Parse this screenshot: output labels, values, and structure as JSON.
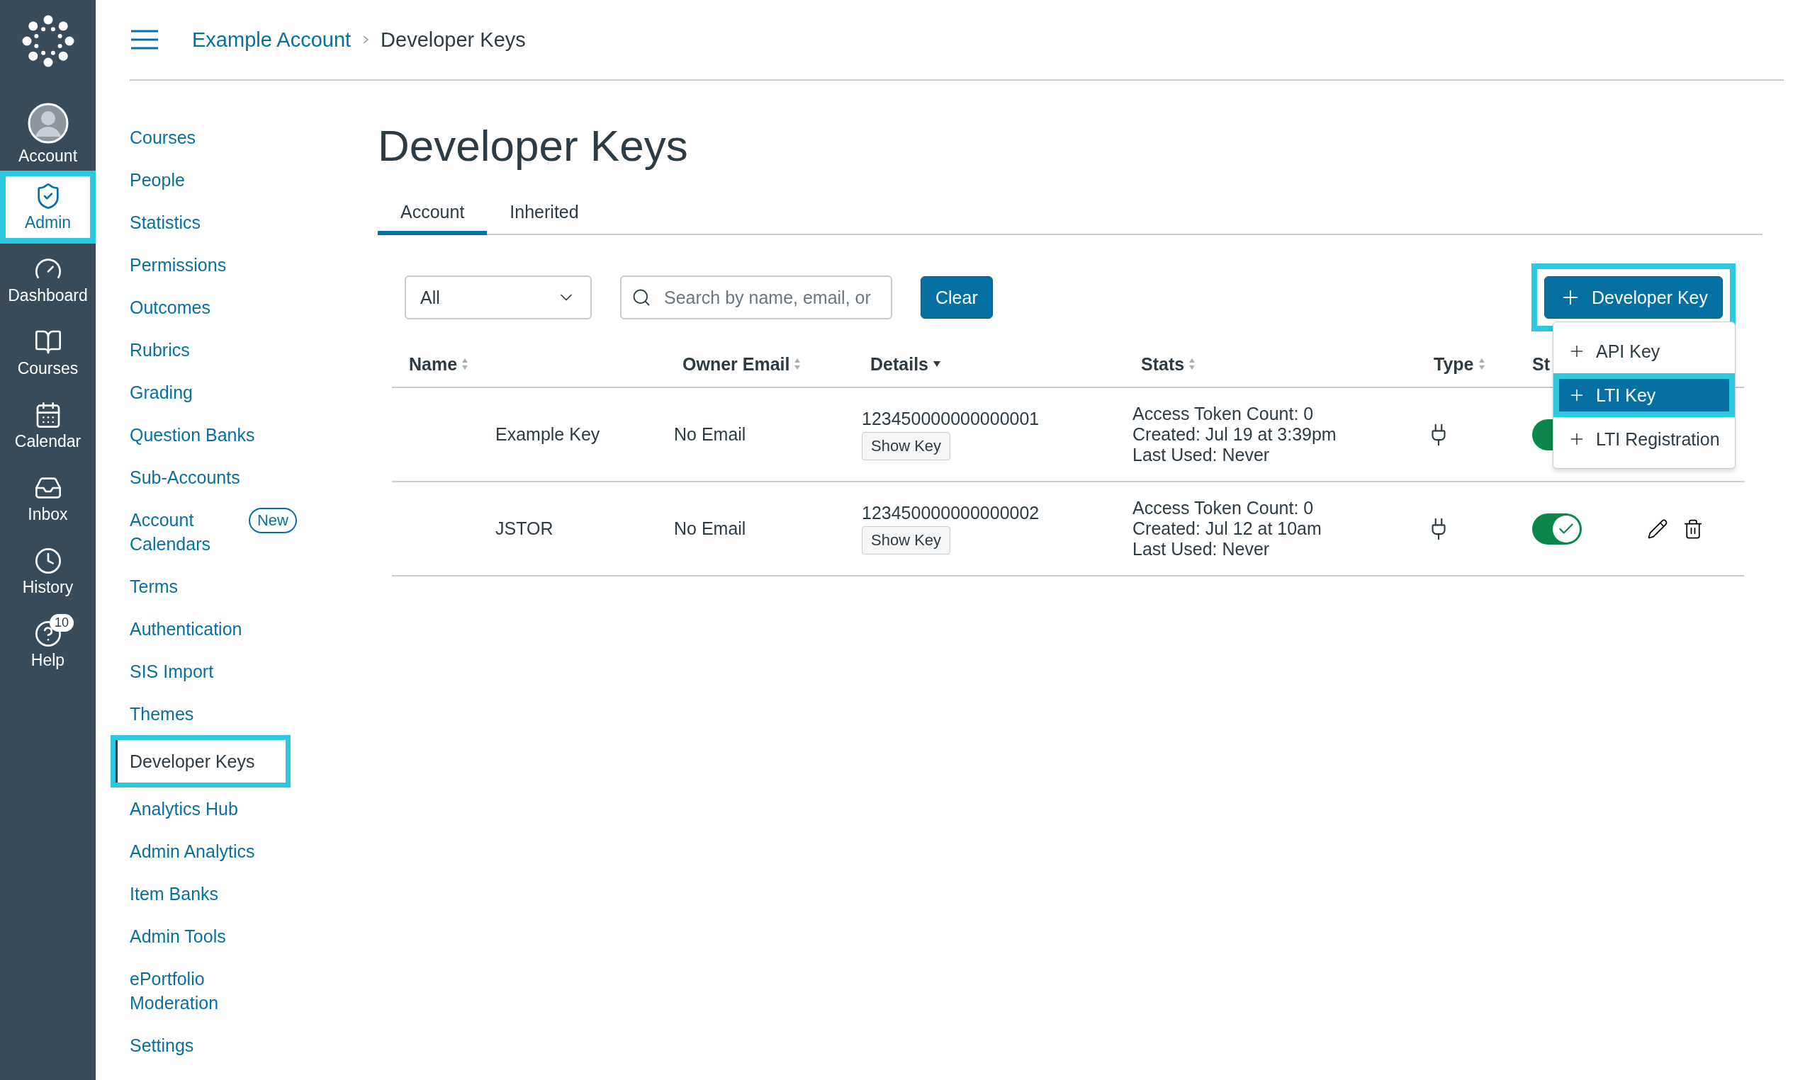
{
  "rail": {
    "items": [
      {
        "label": "Account",
        "kind": "avatar",
        "selected": false,
        "highlighted": false
      },
      {
        "label": "Admin",
        "kind": "admin",
        "selected": true,
        "highlighted": true
      },
      {
        "label": "Dashboard",
        "kind": "dashboard",
        "selected": false,
        "highlighted": false
      },
      {
        "label": "Courses",
        "kind": "courses",
        "selected": false,
        "highlighted": false
      },
      {
        "label": "Calendar",
        "kind": "calendar",
        "selected": false,
        "highlighted": false
      },
      {
        "label": "Inbox",
        "kind": "inbox",
        "selected": false,
        "highlighted": false
      },
      {
        "label": "History",
        "kind": "history",
        "selected": false,
        "highlighted": false
      },
      {
        "label": "Help",
        "kind": "help",
        "selected": false,
        "highlighted": false,
        "badge": "10"
      }
    ]
  },
  "breadcrumb": [
    {
      "label": "Example Account",
      "kind": "link"
    },
    {
      "label": "Developer Keys",
      "kind": "current"
    }
  ],
  "sidebar": {
    "items": [
      {
        "label": "Courses",
        "selected": false,
        "highlighted": false
      },
      {
        "label": "People",
        "selected": false,
        "highlighted": false
      },
      {
        "label": "Statistics",
        "selected": false,
        "highlighted": false
      },
      {
        "label": "Permissions",
        "selected": false,
        "highlighted": false
      },
      {
        "label": "Outcomes",
        "selected": false,
        "highlighted": false
      },
      {
        "label": "Rubrics",
        "selected": false,
        "highlighted": false
      },
      {
        "label": "Grading",
        "selected": false,
        "highlighted": false
      },
      {
        "label": "Question Banks",
        "selected": false,
        "highlighted": false
      },
      {
        "label": "Sub-Accounts",
        "selected": false,
        "highlighted": false
      },
      {
        "label": "Account Calendars",
        "selected": false,
        "highlighted": false,
        "badge": "New"
      },
      {
        "label": "Terms",
        "selected": false,
        "highlighted": false
      },
      {
        "label": "Authentication",
        "selected": false,
        "highlighted": false
      },
      {
        "label": "SIS Import",
        "selected": false,
        "highlighted": false
      },
      {
        "label": "Themes",
        "selected": false,
        "highlighted": false
      },
      {
        "label": "Developer Keys",
        "selected": true,
        "highlighted": true
      },
      {
        "label": "Analytics Hub",
        "selected": false,
        "highlighted": false
      },
      {
        "label": "Admin Analytics",
        "selected": false,
        "highlighted": false
      },
      {
        "label": "Item Banks",
        "selected": false,
        "highlighted": false
      },
      {
        "label": "Admin Tools",
        "selected": false,
        "highlighted": false
      },
      {
        "label": "ePortfolio Moderation",
        "selected": false,
        "highlighted": false
      },
      {
        "label": "Settings",
        "selected": false,
        "highlighted": false
      }
    ]
  },
  "page_title": "Developer Keys",
  "tabs": [
    {
      "label": "Account",
      "selected": true
    },
    {
      "label": "Inherited",
      "selected": false
    }
  ],
  "filter": {
    "value": "All"
  },
  "search": {
    "placeholder": "Search by name, email, or"
  },
  "clear_button": "Clear",
  "add_button": {
    "label": "Developer Key",
    "highlighted": true
  },
  "add_menu": [
    {
      "label": "API Key",
      "selected": false,
      "highlighted": false
    },
    {
      "label": "LTI Key",
      "selected": true,
      "highlighted": true
    },
    {
      "label": "LTI Registration",
      "selected": false,
      "highlighted": false
    }
  ],
  "table": {
    "columns": [
      {
        "label": "Name",
        "sorted": false
      },
      {
        "label": "Owner Email",
        "sorted": false
      },
      {
        "label": "Details",
        "sorted": true
      },
      {
        "label": "Stats",
        "sorted": false
      },
      {
        "label": "Type",
        "sorted": false
      },
      {
        "label": "St"
      }
    ],
    "rows": [
      {
        "name": "Example Key",
        "email": "No Email",
        "id": "123450000000000001",
        "show_key": "Show Key",
        "stats": [
          "Access Token Count: 0",
          "Created: Jul 19 at 3:39pm",
          "Last Used: Never"
        ],
        "on": true,
        "actions_visible": false
      },
      {
        "name": "JSTOR",
        "email": "No Email",
        "id": "123450000000000002",
        "show_key": "Show Key",
        "stats": [
          "Access Token Count: 0",
          "Created: Jul 12 at 10am",
          "Last Used: Never"
        ],
        "on": true,
        "actions_visible": true
      }
    ]
  }
}
